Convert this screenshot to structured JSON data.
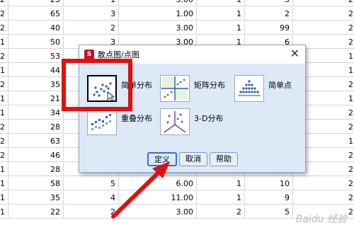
{
  "grid_rows": [
    {
      "c0": "2",
      "c1": "23",
      "c2": "1",
      "c3": "3.00",
      "c4": "1",
      "c5": "5",
      "c6": "2"
    },
    {
      "c0": "2",
      "c1": "65",
      "c2": "3",
      "c3": "1.00",
      "c4": "1",
      "c5": "2",
      "c6": "2"
    },
    {
      "c0": "2",
      "c1": "40",
      "c2": "2",
      "c3": "3.00",
      "c4": "1",
      "c5": "99",
      "c6": "2"
    },
    {
      "c0": "1",
      "c1": "50",
      "c2": "3",
      "c3": "3.00",
      "c4": "1",
      "c5": "6",
      "c6": "2"
    },
    {
      "c0": "2",
      "c1": "53",
      "c2": "",
      "c3": "",
      "c4": "",
      "c5": "",
      "c6": "1"
    },
    {
      "c0": "1",
      "c1": "44",
      "c2": "",
      "c3": "",
      "c4": "",
      "c5": "",
      "c6": "1"
    },
    {
      "c0": "2",
      "c1": "35",
      "c2": "",
      "c3": "",
      "c4": "",
      "c5": "",
      "c6": "2"
    },
    {
      "c0": "1",
      "c1": "21",
      "c2": "",
      "c3": "",
      "c4": "",
      "c5": "",
      "c6": "1"
    },
    {
      "c0": "1",
      "c1": "34",
      "c2": "",
      "c3": "",
      "c4": "",
      "c5": "",
      "c6": "2"
    },
    {
      "c0": "2",
      "c1": "28",
      "c2": "",
      "c3": "",
      "c4": "",
      "c5": "",
      "c6": "2"
    },
    {
      "c0": "2",
      "c1": "63",
      "c2": "",
      "c3": "",
      "c4": "",
      "c5": "",
      "c6": "1"
    },
    {
      "c0": "2",
      "c1": "46",
      "c2": "",
      "c3": "",
      "c4": "",
      "c5": "",
      "c6": "2"
    },
    {
      "c0": "1",
      "c1": "28",
      "c2": "1",
      "c3": "3.00",
      "c4": "2",
      "c5": "7",
      "c6": "2"
    },
    {
      "c0": "1",
      "c1": "58",
      "c2": "5",
      "c3": "6.00",
      "c4": "1",
      "c5": "10",
      "c6": "2"
    },
    {
      "c0": "1",
      "c1": "35",
      "c2": "4",
      "c3": "11.00",
      "c4": "1",
      "c5": "9",
      "c6": "2"
    },
    {
      "c0": "1",
      "c1": "22",
      "c2": "2",
      "c3": "3.00",
      "c4": "2",
      "c5": "5",
      "c6": "2"
    }
  ],
  "dialog": {
    "title": "散点图/点图",
    "app_icon": "spss-app-icon",
    "close_glyph": "✕",
    "options": [
      {
        "label": "简单分布",
        "icon": "simple-scatter-icon"
      },
      {
        "label": "矩阵分布",
        "icon": "matrix-scatter-icon"
      },
      {
        "label": "简单点",
        "icon": "simple-dot-icon"
      },
      {
        "label": "重叠分布",
        "icon": "overlay-scatter-icon"
      },
      {
        "label": "3-D分布",
        "icon": "3d-scatter-icon"
      }
    ],
    "buttons": {
      "define": "定义",
      "cancel": "取消",
      "help": "帮助"
    }
  },
  "annotation": {
    "highlight_color": "#e01010",
    "arrow_color": "#e01010"
  },
  "watermark": "Baidu 经验"
}
